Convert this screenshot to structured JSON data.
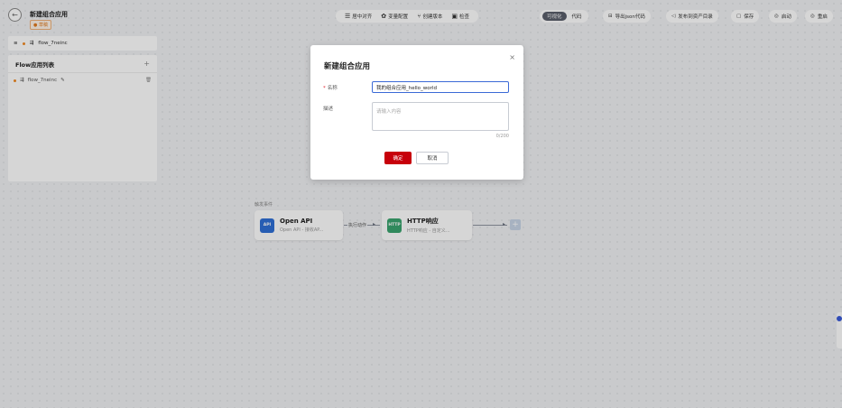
{
  "header": {
    "title": "新建组合应用",
    "badge": "● 草稿"
  },
  "toolbar": {
    "group1": [
      {
        "icon": "align-center-icon",
        "glyph": "☰",
        "label": "居中对齐"
      },
      {
        "icon": "variable-config-icon",
        "glyph": "✿",
        "label": "变量配置"
      },
      {
        "icon": "branch-icon",
        "glyph": "⑂",
        "label": "创建版本"
      },
      {
        "icon": "check-icon",
        "glyph": "▣",
        "label": "检查"
      }
    ],
    "tabs": [
      "可视化",
      "代码"
    ],
    "buttons": [
      {
        "name": "export-json-button",
        "icon": "export-icon",
        "glyph": "⊟",
        "label": "导出json代码"
      },
      {
        "name": "publish-button",
        "icon": "send-icon",
        "glyph": "◁",
        "label": "发布到资产目录"
      },
      {
        "name": "save-button",
        "icon": "save-icon",
        "glyph": "▢",
        "label": "保存"
      },
      {
        "name": "start-button",
        "icon": "start-icon",
        "glyph": "◎",
        "label": "启动"
      },
      {
        "name": "reset-button",
        "icon": "reset-icon",
        "glyph": "◎",
        "label": "重启"
      }
    ]
  },
  "breadcrumb": {
    "label": "flow_7neinc"
  },
  "flow_list": {
    "title": "Flow应用列表",
    "add": "+",
    "items": [
      {
        "label": "flow_7neinc"
      }
    ]
  },
  "canvas": {
    "trigger_label": "触发事件",
    "nodes": [
      {
        "title": "Open API",
        "subtitle": "Open API - 接收AP...",
        "icon_text": "API",
        "icon_color": "#2f6fd6"
      },
      {
        "title": "HTTP响应",
        "subtitle": "HTTP响应 - 自定义...",
        "icon_text": "HTTP",
        "icon_color": "#3aa46e"
      }
    ],
    "edge_label": "执行动作"
  },
  "modal": {
    "title": "新建组合应用",
    "close": "×",
    "name_label": "名称",
    "required_mark": "*",
    "name_value": "我的组合应用_hello_world",
    "desc_label": "描述",
    "desc_placeholder": "请输入内容",
    "counter": "0/200",
    "ok_label": "确定",
    "cancel_label": "取消"
  },
  "colors": {
    "primary": "#c7000b",
    "focus_border": "#3b6ad6",
    "draft": "#f08a24"
  }
}
